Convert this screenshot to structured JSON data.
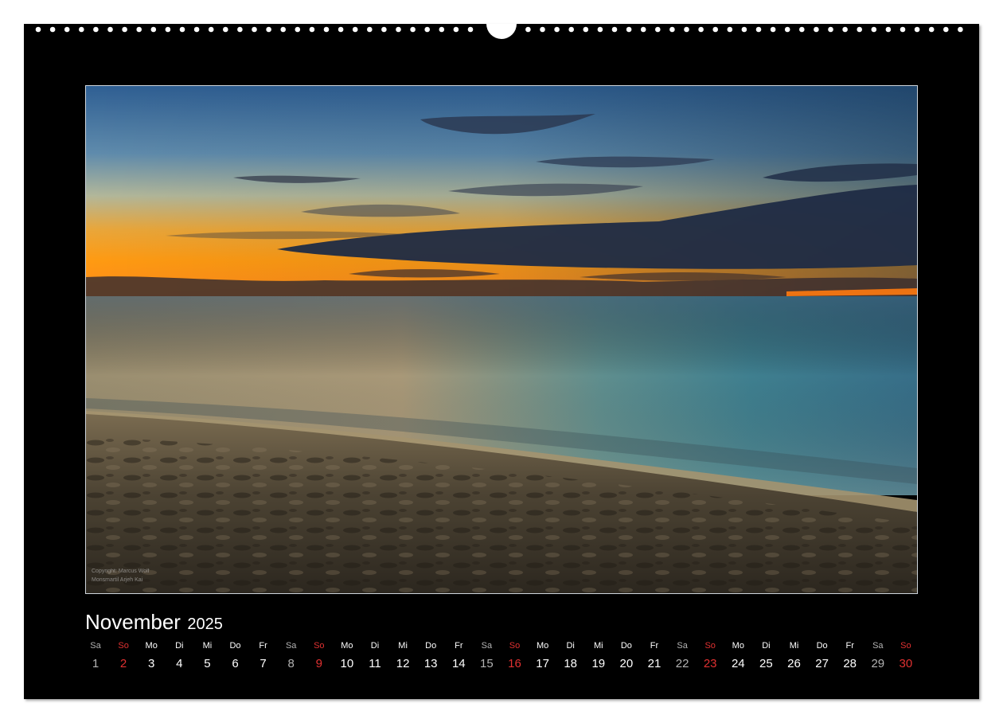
{
  "calendar": {
    "month": "November",
    "year": "2025",
    "weekdays": [
      "Sa",
      "So",
      "Mo",
      "Di",
      "Mi",
      "Do",
      "Fr",
      "Sa",
      "So",
      "Mo",
      "Di",
      "Mi",
      "Do",
      "Fr",
      "Sa",
      "So",
      "Mo",
      "Di",
      "Mi",
      "Do",
      "Fr",
      "Sa",
      "So",
      "Mo",
      "Di",
      "Mi",
      "Do",
      "Fr",
      "Sa",
      "So"
    ],
    "days": [
      "1",
      "2",
      "3",
      "4",
      "5",
      "6",
      "7",
      "8",
      "9",
      "10",
      "11",
      "12",
      "13",
      "14",
      "15",
      "16",
      "17",
      "18",
      "19",
      "20",
      "21",
      "22",
      "23",
      "24",
      "25",
      "26",
      "27",
      "28",
      "29",
      "30"
    ],
    "photo_watermark": [
      "Copyright: Marcus Wolf",
      "Monsmartil Arjeh Kai"
    ]
  },
  "colors": {
    "page_background": "#000000",
    "weekday_text": "#ffffff",
    "saturday_text": "#b3b3b3",
    "sunday_text": "#e03131"
  }
}
